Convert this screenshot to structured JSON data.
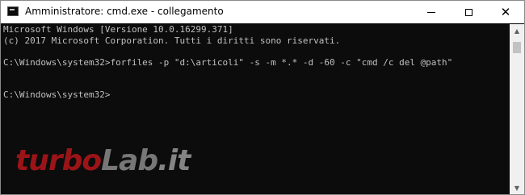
{
  "window": {
    "title": "Amministratore: cmd.exe - collegamento",
    "icon": "cmd-icon",
    "controls": {
      "minimize_icon": "minimize-icon",
      "maximize_icon": "maximize-icon",
      "close_icon": "close-icon",
      "close_glyph": "✕"
    }
  },
  "console": {
    "lines": [
      "Microsoft Windows [Versione 10.0.16299.371]",
      "(c) 2017 Microsoft Corporation. Tutti i diritti sono riservati.",
      "",
      "C:\\Windows\\system32>forfiles -p \"d:\\articoli\" -s -m *.* -d -60 -c \"cmd /c del @path\"",
      "",
      "",
      "C:\\Windows\\system32>"
    ],
    "background": "#0c0c0c",
    "text_color": "#c0c0c0"
  },
  "scrollbar": {
    "up_glyph": "▲",
    "down_glyph": "▼"
  },
  "watermark": {
    "turbo": "turbo",
    "lab": "Lab",
    "it": ".it",
    "colors": {
      "turbo": "#b5161b",
      "lab": "#8a8a8a"
    }
  }
}
